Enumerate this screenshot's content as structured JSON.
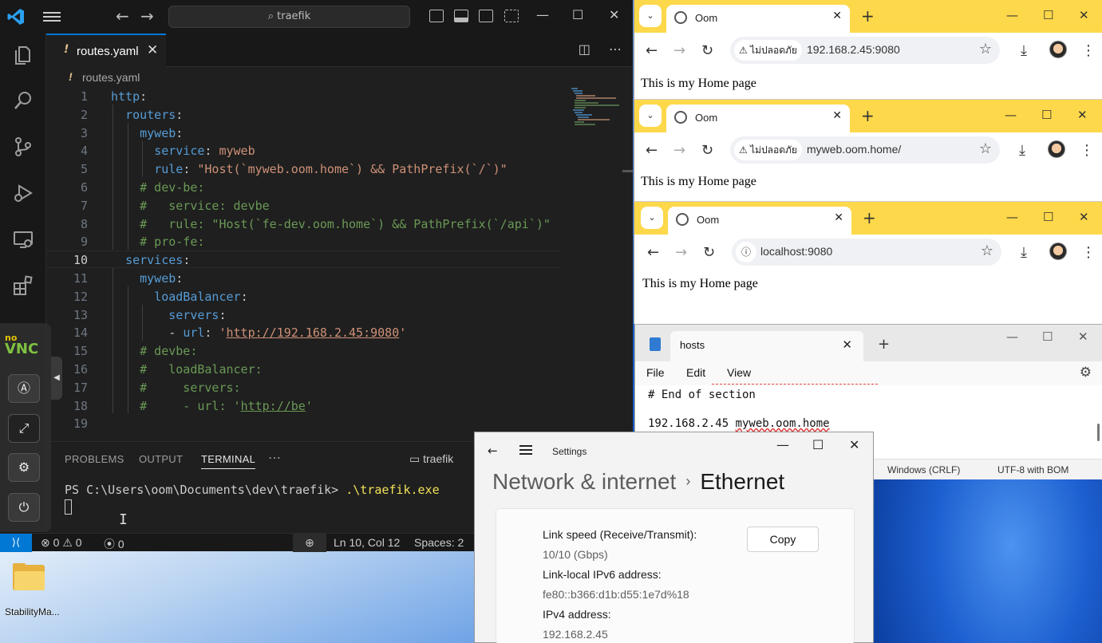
{
  "desktop": {
    "icon_label": "StabilityMa..."
  },
  "vscode": {
    "search_text": "traefik",
    "tab": {
      "label": "routes.yaml",
      "modified_marker": "!"
    },
    "breadcrumb": {
      "marker": "!",
      "file": "routes.yaml"
    },
    "line_numbers": [
      "1",
      "2",
      "3",
      "4",
      "5",
      "6",
      "7",
      "8",
      "9",
      "10",
      "11",
      "12",
      "13",
      "14",
      "15",
      "16",
      "17",
      "18",
      "19"
    ],
    "code": {
      "l1_key": "http",
      "l2_key": "routers",
      "l3_key": "myweb",
      "l4_key": "service",
      "l4_val": "myweb",
      "l5_key": "rule",
      "l5_val": "\"Host(`myweb.oom.home`) && PathPrefix(`/`)\"",
      "l6": "# dev-be:",
      "l7": "#   service: devbe",
      "l8": "#   rule: \"Host(`fe-dev.oom.home`) && PathPrefix(`/api`)\"",
      "l9": "# pro-fe:",
      "l10_key": "services",
      "l11_key": "myweb",
      "l12_key": "loadBalancer",
      "l13_key": "servers",
      "l14_dash": "- ",
      "l14_key": "url",
      "l14_q": "'",
      "l14_url": "http://192.168.2.45:9080",
      "l15": "# devbe:",
      "l16": "#   loadBalancer:",
      "l17": "#     servers:",
      "l18_pre": "#     - url: '",
      "l18_url": "http://be",
      "l18_post": "'"
    },
    "panel": {
      "tabs": [
        "PROBLEMS",
        "OUTPUT",
        "TERMINAL"
      ],
      "terminal_name": "traefik",
      "prompt": "PS C:\\Users\\oom\\Documents\\dev\\traefik> ",
      "command": ".\\traefik.exe"
    },
    "status": {
      "errors": "0",
      "warnings": "0",
      "ports": "0",
      "position": "Ln 10, Col 12",
      "spaces": "Spaces: 2"
    }
  },
  "novnc": {
    "logo_top": "no",
    "logo_bottom": "VNC"
  },
  "chrome_windows": [
    {
      "tab_title": "Oom",
      "badge": "ไม่ปลอดภัย",
      "url": "192.168.2.45:9080",
      "page_text": "This is my Home page"
    },
    {
      "tab_title": "Oom",
      "badge": "ไม่ปลอดภัย",
      "url": "myweb.oom.home/",
      "page_text": "This is my Home page"
    },
    {
      "tab_title": "Oom",
      "badge": "",
      "url": "localhost:9080",
      "page_text": "This is my Home page"
    }
  ],
  "notepad": {
    "tab_title": "hosts",
    "menu": [
      "File",
      "Edit",
      "View"
    ],
    "line1": "# End of section",
    "line2_ip": "192.168.2.45 ",
    "line2_host": "myweb.oom.home",
    "line_ending": "Windows (CRLF)",
    "encoding": "UTF-8 with BOM"
  },
  "settings": {
    "app_title": "Settings",
    "breadcrumb_parent": "Network & internet",
    "breadcrumb_sep": "›",
    "breadcrumb_current": "Ethernet",
    "copy_label": "Copy",
    "rows": [
      {
        "label": "Link speed (Receive/Transmit):",
        "value": "10/10 (Gbps)"
      },
      {
        "label": "Link-local IPv6 address:",
        "value": "fe80::b366:d1b:d55:1e7d%18"
      },
      {
        "label": "IPv4 address:",
        "value": "192.168.2.45"
      }
    ]
  },
  "colors": {
    "vscode_accent": "#0078d4",
    "chrome_tabbar": "#fdd84a",
    "yaml_key": "#569cd6",
    "yaml_string": "#ce9178",
    "yaml_comment": "#6a9955"
  }
}
